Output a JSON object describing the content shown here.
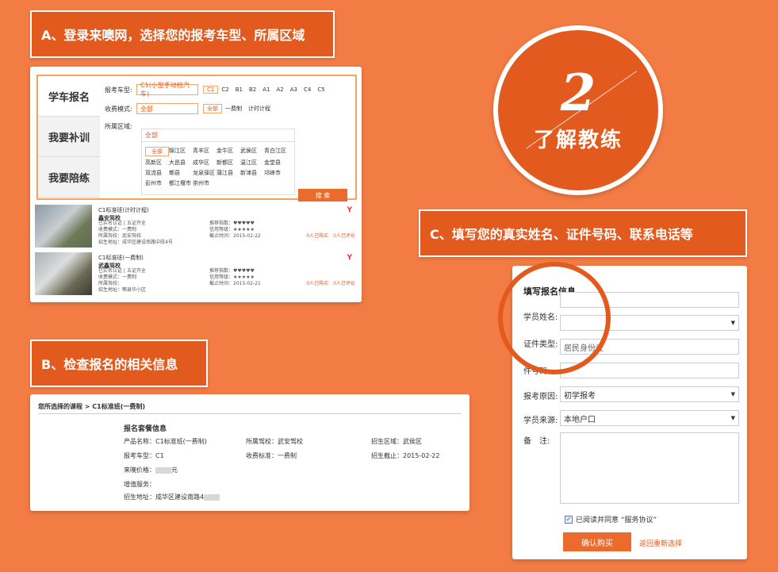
{
  "steps": {
    "a": "A、登录来噢网，选择您的报考车型、所属区域",
    "b": "B、检查报名的相关信息",
    "c": "C、填写您的真实姓名、证件号码、联系电话等"
  },
  "badge": {
    "number": "2",
    "text": "了解教练"
  },
  "panel_a": {
    "tabs": [
      "学车报名",
      "我要补训",
      "我要陪练"
    ],
    "car_label": "报考车型:",
    "car_value": "C1(小型手动档汽车)",
    "car_options": [
      "C1",
      "C2",
      "B1",
      "B2",
      "A1",
      "A2",
      "A3",
      "C4",
      "C5"
    ],
    "fee_label": "收费模式:",
    "fee_value": "全部",
    "fee_options": [
      "全部",
      "一费制",
      "计时计程"
    ],
    "region_label": "所属区域:",
    "region_value": "全部",
    "regions": [
      "全部",
      "锦江区",
      "青羊区",
      "金牛区",
      "武侯区",
      "青白江区",
      "高新区",
      "大邑县",
      "成华区",
      "新都区",
      "温江区",
      "金堂县",
      "双流县",
      "郫县",
      "龙泉驿区",
      "蒲江县",
      "新津县",
      "邛崃市",
      "彭州市",
      "都江堰市",
      "崇州市"
    ],
    "search_btn": "搜 索",
    "listings": [
      {
        "title": "C1标准班(计时计程)",
        "school": "鑫安驾校",
        "l1": "已实名认证 | 五证齐全",
        "l2": "收费模式：一费制",
        "l3": "所属驾校：武安驾校",
        "l4": "招生地址：成华区建设南路中段4号",
        "r1": "推荐指数：♥♥♥♥♥",
        "r2": "信用等级：★★★★★",
        "r3": "截止时间：2015-02-22",
        "price": "Y",
        "bought": "0人已购买",
        "review": "0人已评价"
      },
      {
        "title": "C1标准班(一费制)",
        "school": "武鑫驾校",
        "l1": "已实名认证 | 五证齐全",
        "l2": "收费模式：一费制",
        "l3": "所属驾校：",
        "l4": "招生地址：郫县华小区",
        "r1": "推荐指数：♥♥♥♥♥",
        "r2": "信用等级：★★★★★",
        "r3": "截止时间：2015-02-21",
        "price": "Y",
        "bought": "0人已购买",
        "review": "0人已评价"
      }
    ]
  },
  "panel_b": {
    "breadcrumb": "您所选择的课程 > C1标准班(一费制)",
    "section": "报名套餐信息",
    "product": "产品名称：C1标准班(一费制)",
    "school": "所属驾校：武安驾校",
    "area": "招生区域：武侯区",
    "car": "报考车型：C1",
    "fee": "收费标准：一费制",
    "deadline": "招生截止：2015-02-22",
    "price_label": "来噢价格：",
    "price_unit": "元",
    "service": "增值服务：",
    "address": "招生地址：成华区建设南路4"
  },
  "panel_c": {
    "title": "填写报名信息",
    "name_label": "学员姓名:",
    "id_type_label": "证件类型:",
    "id_type_value": "居民身份证",
    "id_num_label": "件号码:",
    "reason_label": "报考原因:",
    "reason_value": "初学报考",
    "source_label": "学员来源:",
    "source_value": "本地户口",
    "note_label": "备　注:",
    "agree": "已阅读并同意 “服务协议”",
    "confirm": "确认购买",
    "reselect": "返回重新选择"
  }
}
